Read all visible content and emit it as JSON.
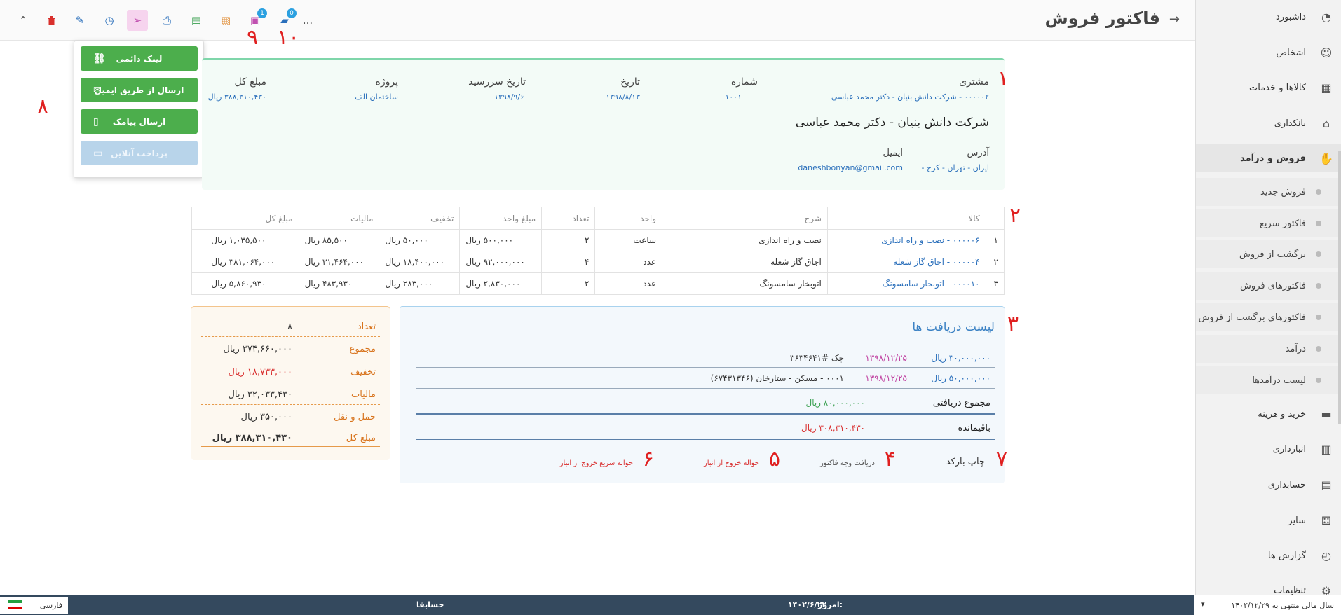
{
  "header": {
    "title": "فاکتور فروش",
    "more": "...",
    "badge_9": "1",
    "badge_10": "0"
  },
  "annotations": {
    "n1": "۱",
    "n2": "۲",
    "n3": "۳",
    "n4": "۴",
    "n5": "۵",
    "n6": "۶",
    "n7": "۷",
    "n8": "۸",
    "n9": "۹",
    "n10": "۱۰"
  },
  "share_menu": {
    "permalink": "لینک دائمی",
    "email": "ارسال از طریق ایمیل",
    "sms": "ارسال پیامک",
    "online_pay": "پرداخت آنلاین"
  },
  "sidebar": {
    "items": [
      {
        "label": "داشبورد",
        "icon": "dashboard-icon"
      },
      {
        "label": "اشخاص",
        "icon": "people-icon"
      },
      {
        "label": "کالاها و خدمات",
        "icon": "goods-icon"
      },
      {
        "label": "بانکداری",
        "icon": "bank-icon"
      },
      {
        "label": "فروش و درآمد",
        "icon": "sales-icon"
      },
      {
        "label": "خرید و هزینه",
        "icon": "purchase-icon"
      },
      {
        "label": "انبارداری",
        "icon": "warehouse-icon"
      },
      {
        "label": "حسابداری",
        "icon": "accounting-icon"
      },
      {
        "label": "سایر",
        "icon": "other-icon"
      },
      {
        "label": "گزارش ها",
        "icon": "reports-icon"
      },
      {
        "label": "تنظیمات",
        "icon": "settings-icon"
      }
    ],
    "sub_items": [
      "فروش جدید",
      "فاکتور سریع",
      "برگشت از فروش",
      "فاکتورهای فروش",
      "فاکتورهای برگشت از فروش",
      "درآمد",
      "لیست درآمدها"
    ]
  },
  "invoice": {
    "customer_label": "مشتری",
    "customer_value": "۰۰۰۰۰۲ - شرکت دانش بنیان - دکتر محمد عباسی",
    "number_label": "شماره",
    "number_value": "۱۰۰۱",
    "date_label": "تاریخ",
    "date_value": "۱۳۹۸/۸/۱۳",
    "due_label": "تاریخ سررسید",
    "due_value": "۱۳۹۸/۹/۶",
    "project_label": "پروژه",
    "project_value": "ساختمان الف",
    "total_label": "مبلغ کل",
    "total_value": "۳۸۸,۳۱۰,۴۳۰ ریال",
    "customer_name": "شرکت دانش بنیان - دکتر محمد عباسی",
    "address_label": "آدرس",
    "address_value": "ایران - تهران - کرج -",
    "email_label": "ایمیل",
    "email_value": "daneshbonyan@gmail.com"
  },
  "items_table": {
    "headers": [
      "",
      "کالا",
      "شرح",
      "واحد",
      "تعداد",
      "مبلغ واحد",
      "تخفیف",
      "مالیات",
      "مبلغ کل",
      ""
    ],
    "rows": [
      [
        "۱",
        "۰۰۰۰۰۶ - نصب و راه اندازی",
        "نصب و راه اندازی",
        "ساعت",
        "۲",
        "۵۰۰,۰۰۰ ریال",
        "۵۰,۰۰۰ ریال",
        "۸۵,۵۰۰ ریال",
        "۱,۰۳۵,۵۰۰ ریال"
      ],
      [
        "۲",
        "۰۰۰۰۰۴ - اجاق گاز شعله",
        "اجاق گاز شعله",
        "عدد",
        "۴",
        "۹۲,۰۰۰,۰۰۰ ریال",
        "۱۸,۴۰۰,۰۰۰ ریال",
        "۳۱,۴۶۴,۰۰۰ ریال",
        "۳۸۱,۰۶۴,۰۰۰ ریال"
      ],
      [
        "۳",
        "۰۰۰۰۱۰ - اتوبخار سامسونگ",
        "اتوبخار سامسونگ",
        "عدد",
        "۲",
        "۲,۸۳۰,۰۰۰ ریال",
        "۲۸۳,۰۰۰ ریال",
        "۴۸۳,۹۳۰ ریال",
        "۵,۸۶۰,۹۳۰ ریال"
      ]
    ]
  },
  "receipts": {
    "title": "لیست دریافت ها",
    "rows": [
      {
        "amount": "۳۰,۰۰۰,۰۰۰ ریال",
        "date": "۱۳۹۸/۱۲/۲۵",
        "desc": "چک #۳۶۳۴۶۴۱"
      },
      {
        "amount": "۵۰,۰۰۰,۰۰۰ ریال",
        "date": "۱۳۹۸/۱۲/۲۵",
        "desc": "۰۰۰۱ - مسکن - ستارخان (۶۷۴۳۱۳۴۶)"
      }
    ],
    "received_label": "مجموع دریافتی",
    "received_value": "۸۰,۰۰۰,۰۰۰ ریال",
    "remaining_label": "باقیمانده",
    "remaining_value": "۳۰۸,۳۱۰,۴۳۰ ریال"
  },
  "totals": [
    {
      "label": "تعداد",
      "value": "۸"
    },
    {
      "label": "مجموع",
      "value": "۳۷۴,۶۶۰,۰۰۰ ریال"
    },
    {
      "label": "تخفیف",
      "value": "۱۸,۷۳۳,۰۰۰ ریال"
    },
    {
      "label": "مالیات",
      "value": "۳۲,۰۳۳,۴۳۰ ریال"
    },
    {
      "label": "حمل و نقل",
      "value": "۳۵۰,۰۰۰ ریال"
    },
    {
      "label": "مبلغ کل",
      "value": "۳۸۸,۳۱۰,۴۳۰ ریال"
    }
  ],
  "actions": {
    "barcode": "چاپ بارکد",
    "receive": "دریافت وجه فاکتور",
    "exit_voucher": "حواله خروج از انبار",
    "quick_exit": "حواله سریع خروج از انبار"
  },
  "footer": {
    "fiscal_year": "سال مالی منتهی به ۱۴۰۲/۱۲/۲۹",
    "today_label": "امروز:",
    "today_value": "۱۴۰۲/۶/۲۲",
    "brand": "حسابفا",
    "language": "فارسی"
  },
  "colors": {
    "accent": "#4cae4c",
    "link": "#2a6fbb",
    "annotation": "#e02020",
    "footer": "#34495e"
  }
}
